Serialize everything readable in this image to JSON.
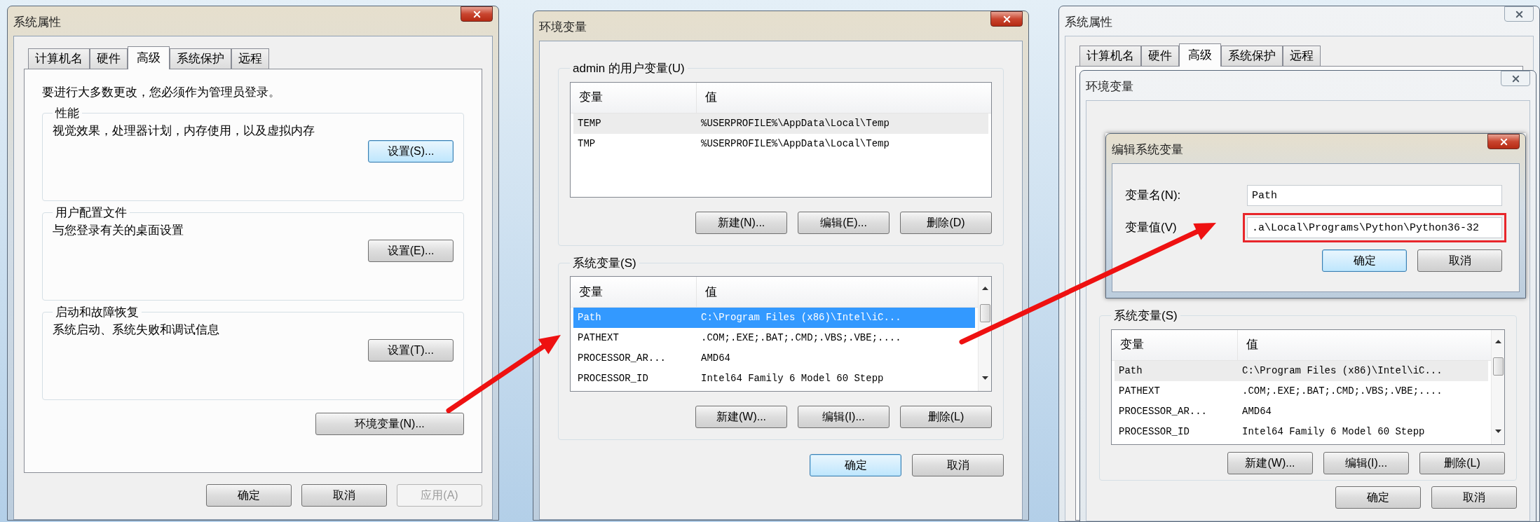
{
  "system_properties": {
    "title": "系统属性",
    "active": true,
    "tabs": [
      {
        "label": "计算机名",
        "selected": false
      },
      {
        "label": "硬件",
        "selected": false
      },
      {
        "label": "高级",
        "selected": true
      },
      {
        "label": "系统保护",
        "selected": false
      },
      {
        "label": "远程",
        "selected": false
      }
    ],
    "notice": "要进行大多数更改，您必须作为管理员登录。",
    "groups": [
      {
        "title": "性能",
        "description": "视觉效果，处理器计划，内存使用，以及虚拟内存",
        "button": {
          "label": "设置(S)...",
          "default": true
        }
      },
      {
        "title": "用户配置文件",
        "description": "与您登录有关的桌面设置",
        "button": {
          "label": "设置(E)...",
          "default": false
        }
      },
      {
        "title": "启动和故障恢复",
        "description": "系统启动、系统失败和调试信息",
        "button": {
          "label": "设置(T)...",
          "default": false
        }
      }
    ],
    "env_button": {
      "label": "环境变量(N)...",
      "default": false
    },
    "buttons": [
      {
        "label": "确定",
        "default": false,
        "disabled": false
      },
      {
        "label": "取消",
        "default": false,
        "disabled": false
      },
      {
        "label": "应用(A)",
        "disabled": true
      }
    ]
  },
  "environment_variables": {
    "title": "环境变量",
    "active": true,
    "sections": [
      {
        "title": "admin 的用户变量(U)",
        "focused": false,
        "columns": [
          "变量",
          "值"
        ],
        "rows": [
          {
            "name": "TEMP",
            "value": "%USERPROFILE%\\AppData\\Local\\Temp",
            "selected": true
          },
          {
            "name": "TMP",
            "value": "%USERPROFILE%\\AppData\\Local\\Temp",
            "selected": false
          }
        ],
        "buttons": [
          {
            "label": "新建(N)...",
            "default": false
          },
          {
            "label": "编辑(E)...",
            "default": false
          },
          {
            "label": "删除(D)",
            "default": false
          }
        ]
      },
      {
        "title": "系统变量(S)",
        "focused": true,
        "columns": [
          "变量",
          "值"
        ],
        "rows": [
          {
            "name": "Path",
            "value": "C:\\Program Files (x86)\\Intel\\iC...",
            "selected": true
          },
          {
            "name": "PATHEXT",
            "value": ".COM;.EXE;.BAT;.CMD;.VBS;.VBE;....",
            "selected": false
          },
          {
            "name": "PROCESSOR_AR...",
            "value": "AMD64",
            "selected": false
          },
          {
            "name": "PROCESSOR_ID",
            "value": "Intel64 Family 6 Model 60 Stepp",
            "selected": false
          }
        ],
        "buttons": [
          {
            "label": "新建(W)...",
            "default": false
          },
          {
            "label": "编辑(I)...",
            "default": false
          },
          {
            "label": "删除(L)",
            "default": false
          }
        ]
      }
    ],
    "buttons": [
      {
        "label": "确定",
        "default": true
      },
      {
        "label": "取消",
        "default": false
      }
    ]
  },
  "edit_view": {
    "system_properties": {
      "title": "系统属性",
      "active": false,
      "tabs": [
        {
          "label": "计算机名",
          "selected": false
        },
        {
          "label": "硬件",
          "selected": false
        },
        {
          "label": "高级",
          "selected": true
        },
        {
          "label": "系统保护",
          "selected": false
        },
        {
          "label": "远程",
          "selected": false
        }
      ]
    },
    "environment_variables": {
      "title": "环境变量",
      "active": false,
      "section": {
        "title": "系统变量(S)",
        "focused": false,
        "columns": [
          "变量",
          "值"
        ],
        "rows": [
          {
            "name": "Path",
            "value": "C:\\Program Files (x86)\\Intel\\iC...",
            "selected": true
          },
          {
            "name": "PATHEXT",
            "value": ".COM;.EXE;.BAT;.CMD;.VBS;.VBE;....",
            "selected": false
          },
          {
            "name": "PROCESSOR_AR...",
            "value": "AMD64",
            "selected": false
          },
          {
            "name": "PROCESSOR_ID",
            "value": "Intel64 Family 6 Model 60 Stepp",
            "selected": false
          }
        ],
        "buttons": [
          {
            "label": "新建(W)...",
            "default": false
          },
          {
            "label": "编辑(I)...",
            "default": false
          },
          {
            "label": "删除(L)",
            "default": false
          }
        ]
      },
      "buttons": [
        {
          "label": "确定",
          "default": false
        },
        {
          "label": "取消",
          "default": false
        }
      ]
    },
    "edit_dialog": {
      "title": "编辑系统变量",
      "active": true,
      "fields": [
        {
          "label": "变量名(N):",
          "value": "Path",
          "highlighted": false
        },
        {
          "label": "变量值(V)",
          "value": ".a\\Local\\Programs\\Python\\Python36-32",
          "highlighted": true
        }
      ],
      "buttons": [
        {
          "label": "确定",
          "default": true
        },
        {
          "label": "取消",
          "default": false
        }
      ]
    }
  }
}
